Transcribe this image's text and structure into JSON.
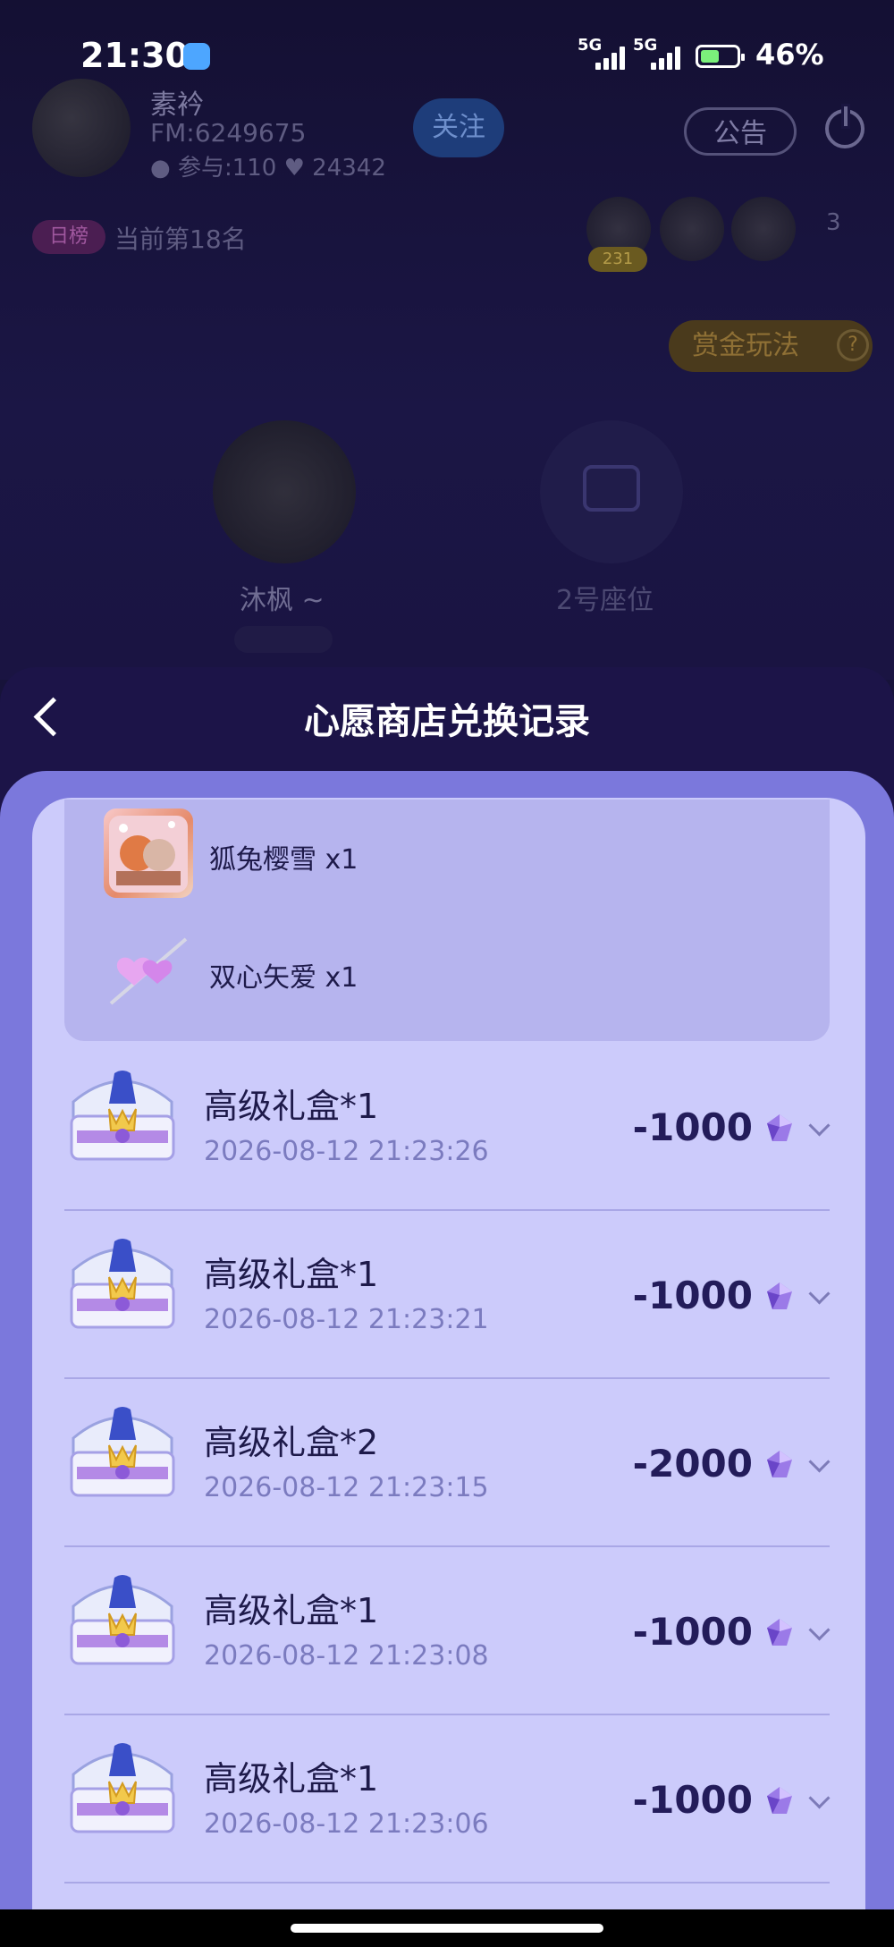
{
  "status_bar": {
    "time": "21:30",
    "net1": "5G",
    "net2": "5G",
    "battery": "46%"
  },
  "room": {
    "host_name": "素衿",
    "host_fm": "FM:6249675",
    "host_stats": "● 参与:110  ♥ 24342",
    "follow_label": "关注",
    "notice_label": "公告",
    "rank_tag": "日榜",
    "rank_text": "当前第18名",
    "audience_badge": "231",
    "audience_count": "3",
    "bounty_label": "赏金玩法",
    "help_icon": "?",
    "seat1_name": "沐枫 ~",
    "seat2_name": "2号座位"
  },
  "sheet": {
    "title": "心愿商店兑换记录",
    "gifts": [
      {
        "label": "狐兔樱雪 x1",
        "icon": "fox-rabbit-gift-icon"
      },
      {
        "label": "双心矢爱 x1",
        "icon": "hearts-arrow-gift-icon"
      }
    ],
    "records": [
      {
        "title": "高级礼盒*1",
        "time": "2026-08-12 21:23:26",
        "amount": "-1000"
      },
      {
        "title": "高级礼盒*1",
        "time": "2026-08-12 21:23:21",
        "amount": "-1000"
      },
      {
        "title": "高级礼盒*2",
        "time": "2026-08-12 21:23:15",
        "amount": "-2000"
      },
      {
        "title": "高级礼盒*1",
        "time": "2026-08-12 21:23:08",
        "amount": "-1000"
      },
      {
        "title": "高级礼盒*1",
        "time": "2026-08-12 21:23:06",
        "amount": "-1000"
      }
    ]
  }
}
